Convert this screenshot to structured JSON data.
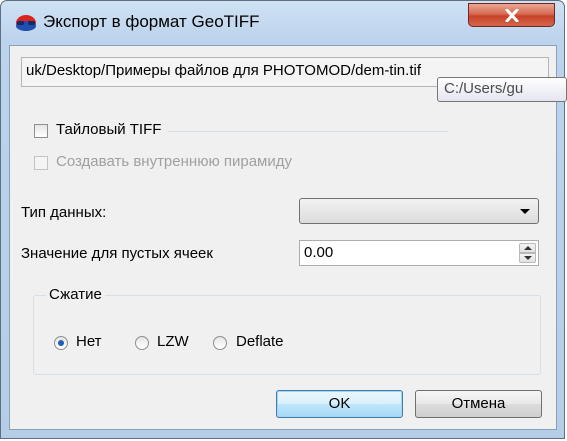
{
  "window": {
    "title": "Экспорт в формат GeoTIFF"
  },
  "path_field": {
    "value": "uk/Desktop/Примеры файлов для PHOTOMOD/dem-tin.tif"
  },
  "tooltip": {
    "text": "C:/Users/gu"
  },
  "options": {
    "tiled_tiff_label": "Тайловый TIFF",
    "tiled_tiff_checked": false,
    "internal_pyramid_label": "Создавать внутреннюю пирамиду",
    "internal_pyramid_checked": false,
    "internal_pyramid_enabled": false
  },
  "data_type": {
    "label": "Тип данных:",
    "selected": ""
  },
  "empty_value": {
    "label": "Значение для пустых ячеек",
    "value": "0.00"
  },
  "compression": {
    "title": "Сжатие",
    "options": [
      {
        "label": "Нет",
        "checked": true
      },
      {
        "label": "LZW",
        "checked": false
      },
      {
        "label": "Deflate",
        "checked": false
      }
    ]
  },
  "buttons": {
    "ok": "OK",
    "cancel": "Отмена"
  },
  "icons": {
    "app": "red-blue-glasses-icon",
    "close": "close-icon",
    "dropdown": "chevron-down-icon",
    "spin": "spin-arrows-icon"
  },
  "colors": {
    "title_gradient_top": "#cfe2f4",
    "close_button": "#c7432a",
    "radio_dot": "#1c5fb7",
    "default_button_border": "#3c7fb1"
  }
}
